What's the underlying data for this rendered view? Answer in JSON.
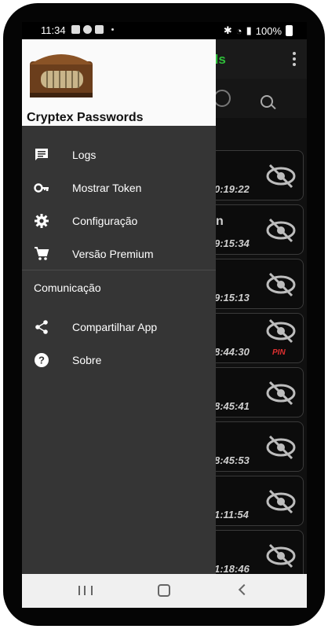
{
  "status_bar": {
    "time": "11:34",
    "battery": "100%"
  },
  "app": {
    "title_tail": "ds",
    "cards": [
      {
        "text": "",
        "timestamp": "0:19:22",
        "pin": ""
      },
      {
        "text": "n",
        "timestamp": "9:15:34",
        "pin": ""
      },
      {
        "text": "",
        "timestamp": "9:15:13",
        "pin": ""
      },
      {
        "text": "",
        "timestamp": "8:44:30",
        "pin": "PIN"
      },
      {
        "text": "",
        "timestamp": "8:45:41",
        "pin": ""
      },
      {
        "text": "",
        "timestamp": "8:45:53",
        "pin": ""
      },
      {
        "text": "",
        "timestamp": "1:11:54",
        "pin": ""
      },
      {
        "text": "",
        "timestamp": "1:18:46",
        "pin": ""
      }
    ]
  },
  "drawer": {
    "title": "Cryptex Passwords",
    "items": [
      {
        "label": "Logs",
        "icon": "message-icon"
      },
      {
        "label": "Mostrar Token",
        "icon": "key-icon"
      },
      {
        "label": "Configuração",
        "icon": "gear-icon"
      },
      {
        "label": "Versão Premium",
        "icon": "cart-icon"
      }
    ],
    "section": "Comunicação",
    "section_items": [
      {
        "label": "Compartilhar App",
        "icon": "share-icon"
      },
      {
        "label": "Sobre",
        "icon": "help-icon"
      }
    ]
  },
  "colors": {
    "accent": "#2fbf3a",
    "drawer_bg": "#353535",
    "pin": "#e03030"
  }
}
